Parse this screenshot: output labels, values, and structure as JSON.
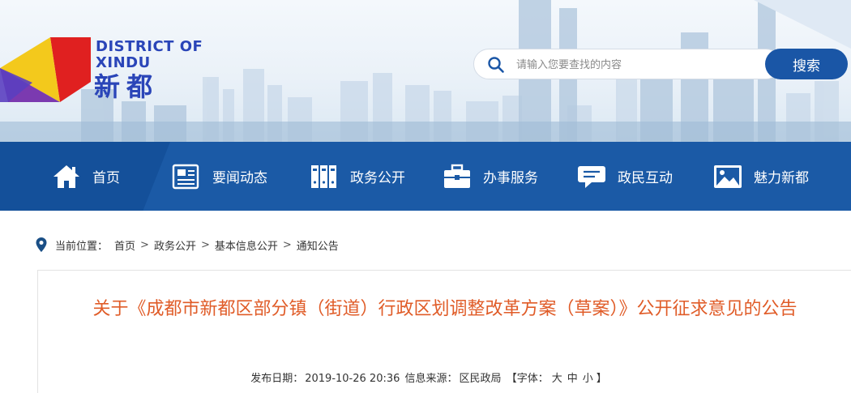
{
  "logo": {
    "en_line1": "DISTRICT OF",
    "en_line2": "XINDU",
    "cn": "新都",
    "colors": [
      "#e02020",
      "#f3c91c",
      "#7b3ab0",
      "#2a45b8"
    ]
  },
  "search": {
    "placeholder": "请输入您要查找的内容",
    "button_label": "搜索"
  },
  "nav": {
    "items": [
      {
        "label": "首页",
        "icon": "home-icon"
      },
      {
        "label": "要闻动态",
        "icon": "news-icon"
      },
      {
        "label": "政务公开",
        "icon": "files-icon"
      },
      {
        "label": "办事服务",
        "icon": "briefcase-icon"
      },
      {
        "label": "政民互动",
        "icon": "chat-icon"
      },
      {
        "label": "魅力新都",
        "icon": "picture-icon"
      }
    ]
  },
  "breadcrumb": {
    "prefix": "当前位置：",
    "items": [
      "首页",
      "政务公开",
      "基本信息公开",
      "通知公告"
    ],
    "separator": ">"
  },
  "article": {
    "title": "关于《成都市新都区部分镇（街道）行政区划调整改革方案（草案）》公开征求意见的公告",
    "meta": {
      "date_label": "发布日期：",
      "date": "2019-10-26 20:36",
      "source_label": "信息来源：",
      "source": "区民政局",
      "font_open": "【字体：",
      "font_large": "大",
      "font_medium": "中",
      "font_small": "小",
      "font_close": "】"
    }
  },
  "colors": {
    "nav_bg": "#1b5aa6",
    "title": "#e05c28",
    "accent": "#1a56a6"
  }
}
